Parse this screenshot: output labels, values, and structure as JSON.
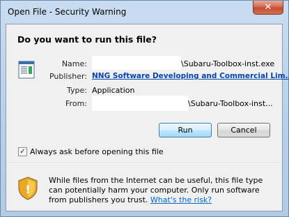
{
  "window": {
    "title": "Open File - Security Warning",
    "close_glyph": "✕"
  },
  "dialog": {
    "heading": "Do you want to run this file?",
    "fields": {
      "name_label": "Name:",
      "name_value": "\\Subaru-Toolbox-inst.exe",
      "publisher_label": "Publisher:",
      "publisher_value": "NNG Software Developing and Commercial Lim...",
      "type_label": "Type:",
      "type_value": "Application",
      "from_label": "From:",
      "from_value": "\\Subaru-Toolbox-inst..."
    },
    "buttons": {
      "run": "Run",
      "cancel": "Cancel"
    },
    "checkbox": {
      "label": "Always ask before opening this file",
      "checked": true,
      "check_glyph": "✓"
    },
    "warning": {
      "text": "While files from the Internet can be useful, this file type can potentially harm your computer. Only run software from publishers you trust.",
      "link": "What's the risk?"
    }
  },
  "colors": {
    "link": "#0645ad",
    "titlebar": "#c9dcf1",
    "close_button": "#c24a32"
  }
}
